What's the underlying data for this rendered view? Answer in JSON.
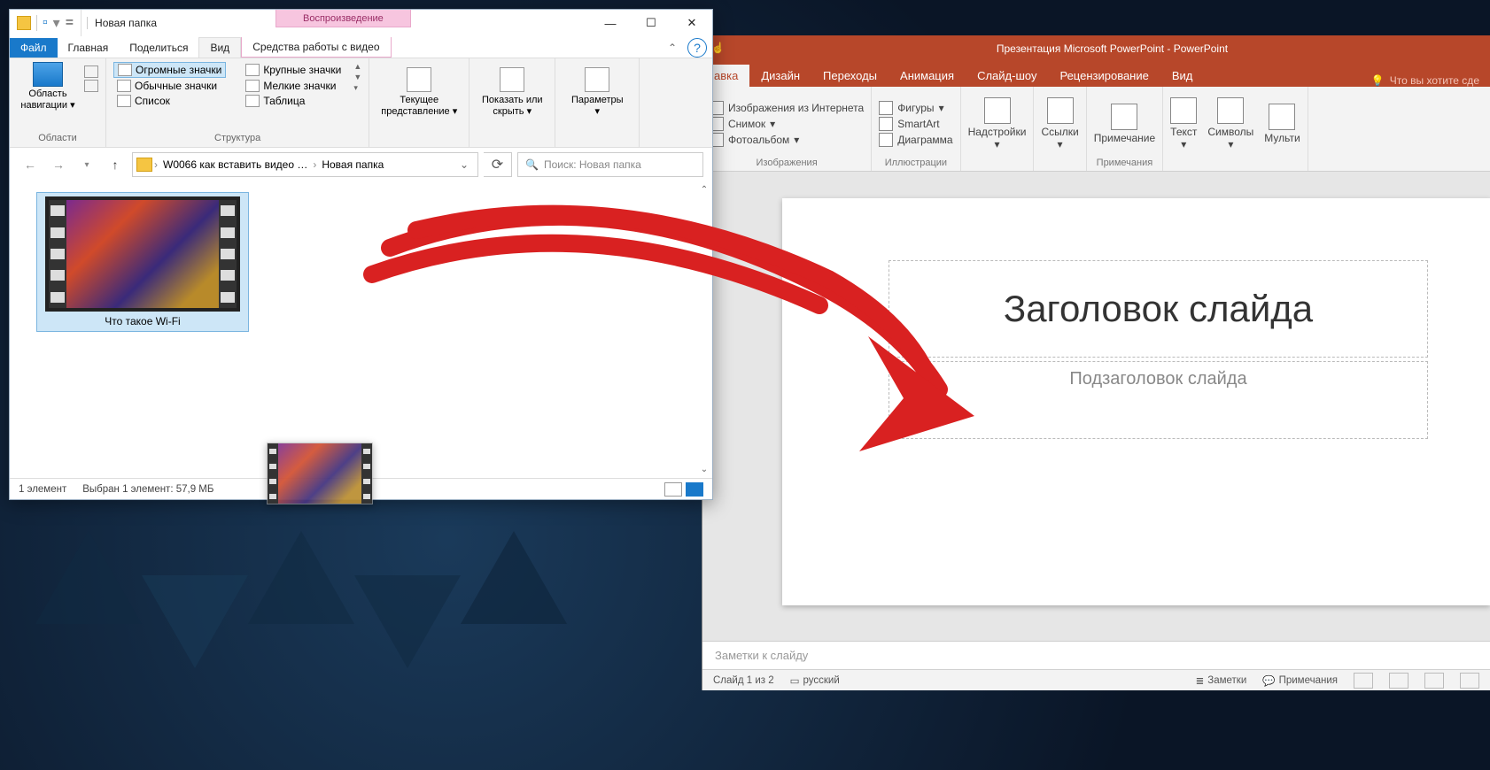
{
  "explorer": {
    "title": "Новая папка",
    "context_tab": "Воспроизведение",
    "tabs": {
      "file": "Файл",
      "home": "Главная",
      "share": "Поделиться",
      "view": "Вид",
      "video_tools": "Средства работы с видео"
    },
    "ribbon": {
      "nav_pane": "Область навигации",
      "group_panes": "Области",
      "layouts": {
        "extra_large": "Огромные значки",
        "large": "Крупные значки",
        "medium": "Обычные значки",
        "small": "Мелкие значки",
        "list": "Список",
        "details": "Таблица"
      },
      "group_layout": "Структура",
      "current_view": "Текущее представление",
      "show_hide": "Показать или скрыть",
      "options": "Параметры"
    },
    "breadcrumb": {
      "parent": "W0066 как вставить видео …",
      "current": "Новая папка"
    },
    "search_placeholder": "Поиск: Новая папка",
    "file": {
      "name": "Что такое Wi-Fi"
    },
    "status": {
      "count": "1 элемент",
      "selection": "Выбран 1 элемент: 57,9 МБ"
    }
  },
  "powerpoint": {
    "title": "Презентация Microsoft PowerPoint - PowerPoint",
    "tabs": {
      "insert_active_suffix": "авка",
      "design": "Дизайн",
      "transitions": "Переходы",
      "animations": "Анимация",
      "slideshow": "Слайд-шоу",
      "review": "Рецензирование",
      "view": "Вид",
      "tell_me": "Что вы хотите сде"
    },
    "ribbon": {
      "online_images": "Изображения из Интернета",
      "screenshot": "Снимок",
      "photo_album": "Фотоальбом",
      "group_images": "Изображения",
      "shapes": "Фигуры",
      "smartart": "SmartArt",
      "chart": "Диаграмма",
      "group_illustrations": "Иллюстрации",
      "addins": "Надстройки",
      "links": "Ссылки",
      "comment": "Примечание",
      "group_comments": "Примечания",
      "text": "Текст",
      "symbols": "Символы",
      "media": "Мульти"
    },
    "slide": {
      "title_placeholder": "Заголовок слайда",
      "subtitle_placeholder": "Подзаголовок слайда"
    },
    "notes_placeholder": "Заметки к слайду",
    "status": {
      "slide_of": "Слайд 1 из 2",
      "language": "русский",
      "notes_btn": "Заметки",
      "comments_btn": "Примечания"
    }
  }
}
